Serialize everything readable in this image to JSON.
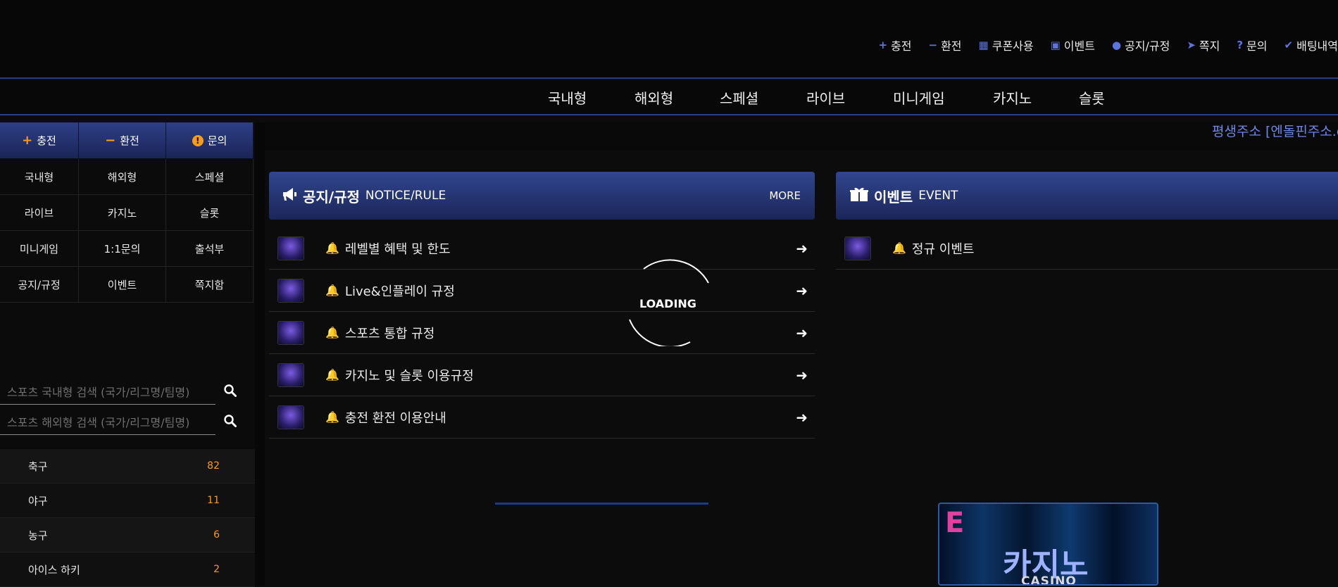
{
  "top_links": [
    {
      "icon": "plus-icon",
      "glyph": "+",
      "label": "충전"
    },
    {
      "icon": "minus-icon",
      "glyph": "−",
      "label": "환전"
    },
    {
      "icon": "gift-icon",
      "glyph": "▦",
      "label": "쿠폰사용"
    },
    {
      "icon": "calendar-check-icon",
      "glyph": "▣",
      "label": "이벤트"
    },
    {
      "icon": "info-icon",
      "glyph": "●",
      "label": "공지/규정"
    },
    {
      "icon": "paper-plane-icon",
      "glyph": "➤",
      "label": "쪽지"
    },
    {
      "icon": "question-icon",
      "glyph": "?",
      "label": "문의"
    },
    {
      "icon": "check-icon",
      "glyph": "✔",
      "label": "배팅내역"
    }
  ],
  "main_nav": [
    "국내형",
    "해외형",
    "스페셜",
    "라이브",
    "미니게임",
    "카지노",
    "슬롯"
  ],
  "sidebar": {
    "quick_buttons": [
      {
        "icon": "plus-icon",
        "glyph": "+",
        "label": "충전"
      },
      {
        "icon": "minus-icon",
        "glyph": "−",
        "label": "환전"
      },
      {
        "icon": "info-icon",
        "glyph": "!",
        "label": "문의"
      }
    ],
    "grid": [
      "국내형",
      "해외형",
      "스페셜",
      "라이브",
      "카지노",
      "슬롯",
      "미니게임",
      "1:1문의",
      "출석부",
      "공지/규정",
      "이벤트",
      "쪽지함"
    ],
    "search_domestic_placeholder": "스포츠 국내형 검색 (국가/리그명/팀명)",
    "search_overseas_placeholder": "스포츠 해외형 검색 (국가/리그명/팀명)",
    "sports": [
      {
        "name": "축구",
        "count": "82"
      },
      {
        "name": "야구",
        "count": "11"
      },
      {
        "name": "농구",
        "count": "6"
      },
      {
        "name": "아이스 하키",
        "count": "2"
      }
    ]
  },
  "marquee": "평생주소 [엔돌핀주소.c",
  "notice": {
    "title": "공지/규정",
    "subtitle": "NOTICE/RULE",
    "more": "MORE",
    "items": [
      "레벨별 혜택 및 한도",
      "Live&인플레이 규정",
      "스포츠 통합 규정",
      "카지노 및 슬롯 이용규정",
      "충전 환전 이용안내"
    ]
  },
  "event": {
    "title": "이벤트",
    "subtitle": "EVENT",
    "items": [
      "정규 이벤트"
    ]
  },
  "loading": "LOADING",
  "casino_banner": {
    "korean": "카지노",
    "english": "CASINO",
    "logo": "E"
  },
  "colors": {
    "accent": "#2a3b86",
    "orange": "#ff9a1a",
    "link_blue": "#6f87e6"
  }
}
